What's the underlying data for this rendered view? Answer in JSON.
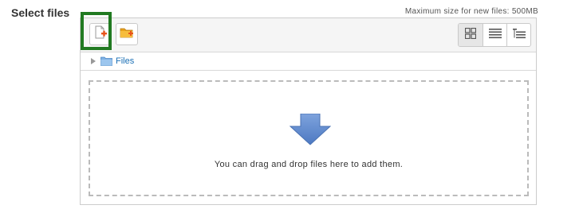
{
  "field": {
    "label": "Select files"
  },
  "filemanager": {
    "max_size_text": "Maximum size for new files: 500MB",
    "toolbar": {
      "add_button_icon": "add-file-icon",
      "create_folder_icon": "create-folder-icon",
      "views": [
        {
          "name": "icons",
          "icon": "grid-icon",
          "active": true
        },
        {
          "name": "list",
          "icon": "list-icon",
          "active": false
        },
        {
          "name": "tree",
          "icon": "tree-icon",
          "active": false
        }
      ]
    },
    "path": {
      "folder_label": "Files"
    },
    "dropzone": {
      "message": "You can drag and drop files here to add them."
    },
    "colors": {
      "highlight_border": "#217a21",
      "link": "#1a6fb5",
      "arrow": "#5b85c8",
      "add_plus": "#e8541b",
      "folder": "#e8a21b"
    }
  }
}
